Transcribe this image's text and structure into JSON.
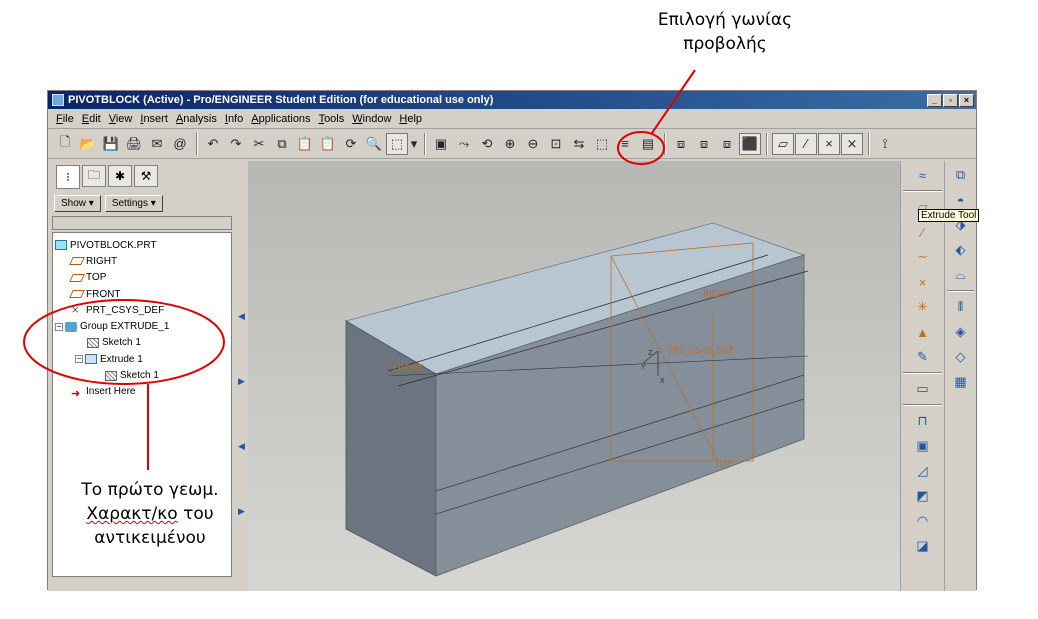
{
  "annotations": {
    "top_line1": "Επιλογή γωνίας",
    "top_line2": "προβολής",
    "bottom_line1": "Το πρώτο γεωμ.",
    "bottom_line2_word1": "Χαρακτ/κο",
    "bottom_line2_word2": "του",
    "bottom_line3": "αντικειμένου",
    "circle_color": "#e00000"
  },
  "window": {
    "title": "PIVOTBLOCK (Active) - Pro/ENGINEER Student Edition (for educational use only)",
    "minimize": "_",
    "maximize": "▫",
    "close": "×"
  },
  "menu": [
    {
      "key": "F",
      "rest": "ile"
    },
    {
      "key": "E",
      "rest": "dit"
    },
    {
      "key": "V",
      "rest": "iew"
    },
    {
      "key": "I",
      "rest": "nsert"
    },
    {
      "key": "A",
      "rest": "nalysis"
    },
    {
      "key": "I",
      "rest": "nfo"
    },
    {
      "key": "A",
      "rest": "pplications"
    },
    {
      "key": "T",
      "rest": "ools"
    },
    {
      "key": "W",
      "rest": "indow"
    },
    {
      "key": "H",
      "rest": "elp"
    }
  ],
  "toolbar_icons": {
    "new": "🗋",
    "open": "📂",
    "save": "💾",
    "print": "🖨",
    "send": "✉",
    "email": "@",
    "undo": "↶",
    "redo": "↷",
    "cut": "✂",
    "copy": "⧉",
    "paste": "📋",
    "paste_special": "📋",
    "regen": "⟳",
    "find": "🔍",
    "select_box": "⬚",
    "dropdown": "▾",
    "repaint": "▣",
    "spin": "⤳",
    "orient": "⟲",
    "zoom_in": "⊕",
    "zoom_out": "⊖",
    "refit": "⊡",
    "saved_views": "⇆",
    "reorient": "⬚",
    "layers": "≡",
    "view_mgr": "▤",
    "wireframe": "⧈",
    "hidden": "⧈",
    "no_hidden": "⧈",
    "shaded": "⬛",
    "datum_planes": "▱",
    "datum_axes": "⁄",
    "datum_points": "×",
    "csys": "⨯",
    "whats_this": "⟟"
  },
  "leftpane": {
    "show_label": "Show ▾",
    "settings_label": "Settings ▾",
    "tree": [
      {
        "label": "PIVOTBLOCK.PRT",
        "indent": 0,
        "icon": "part"
      },
      {
        "label": "RIGHT",
        "indent": 1,
        "icon": "plane"
      },
      {
        "label": "TOP",
        "indent": 1,
        "icon": "plane"
      },
      {
        "label": "FRONT",
        "indent": 1,
        "icon": "plane"
      },
      {
        "label": "PRT_CSYS_DEF",
        "indent": 1,
        "icon": "csys"
      },
      {
        "label": "Group EXTRUDE_1",
        "indent": 0,
        "icon": "group",
        "expander": "−"
      },
      {
        "label": "Sketch 1",
        "indent": 2,
        "icon": "sketch"
      },
      {
        "label": "Extrude 1",
        "indent": 1,
        "icon": "extrude",
        "expander": "−"
      },
      {
        "label": "Sketch 1",
        "indent": 3,
        "icon": "sketch"
      },
      {
        "label": "Insert Here",
        "indent": 1,
        "icon": "insert"
      }
    ]
  },
  "viewport": {
    "datum_right": "RIGHT",
    "datum_front": "FRONT",
    "datum_top": "TOP",
    "csys_label": "PRT_CSYS_DEF",
    "axis_z": "Z",
    "axis_y": "Y",
    "axis_x": "X"
  },
  "rightbar": {
    "tooltip": "Extrude Tool"
  }
}
